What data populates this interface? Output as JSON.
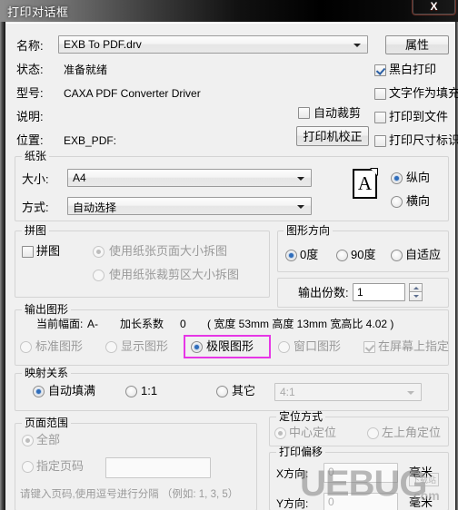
{
  "window": {
    "title": "打印对话框",
    "close_label": "X"
  },
  "printer": {
    "name_label": "名称:",
    "name_value": "EXB To PDF.drv",
    "properties_button": "属性",
    "status_label": "状态:",
    "status_value": "准备就绪",
    "model_label": "型号:",
    "model_value": "CAXA PDF Converter Driver",
    "desc_label": "说明:",
    "desc_value": "",
    "location_label": "位置:",
    "location_value": "EXB_PDF:",
    "auto_crop_label": "自动裁剪",
    "auto_crop_checked": false,
    "calibrate_button": "打印机校正",
    "options": [
      {
        "label": "黑白打印",
        "checked": true,
        "disabled": false
      },
      {
        "label": "文字作为填充",
        "checked": false,
        "disabled": false
      },
      {
        "label": "打印到文件",
        "checked": false,
        "disabled": false
      },
      {
        "label": "打印尺寸标识",
        "checked": false,
        "disabled": false
      }
    ]
  },
  "paper": {
    "group_title": "纸张",
    "size_label": "大小:",
    "size_value": "A4",
    "method_label": "方式:",
    "method_value": "自动选择",
    "icon_letter": "A",
    "orientation": [
      {
        "label": "纵向",
        "selected": true
      },
      {
        "label": "横向",
        "selected": false
      }
    ]
  },
  "tile": {
    "group_title": "拼图",
    "enable_label": "拼图",
    "enable_checked": false,
    "options": [
      {
        "label": "使用纸张页面大小拆图",
        "selected": true,
        "disabled": true
      },
      {
        "label": "使用纸张裁剪区大小拆图",
        "selected": false,
        "disabled": true
      }
    ]
  },
  "graphic_direction": {
    "group_title": "图形方向",
    "options": [
      {
        "label": "0度",
        "selected": true
      },
      {
        "label": "90度",
        "selected": false
      },
      {
        "label": "自适应",
        "selected": false
      }
    ],
    "copies_label": "输出份数:",
    "copies_value": "1"
  },
  "output_graphic": {
    "group_title": "输出图形",
    "current_size_label": "当前幅面:",
    "current_size_value": "A-",
    "extend_label": "加长系数",
    "extend_value": "0",
    "dims_text": "( 宽度 53mm      高度 13mm      宽高比 4.02  )",
    "width_label": "宽度",
    "width_value": "53mm",
    "height_label": "高度",
    "height_value": "13mm",
    "ratio_label": "宽高比",
    "ratio_value": "4.02",
    "options": [
      {
        "label": "标准图形",
        "selected": false,
        "disabled": true
      },
      {
        "label": "显示图形",
        "selected": false,
        "disabled": true
      },
      {
        "label": "极限图形",
        "selected": true,
        "disabled": false,
        "highlighted": true
      },
      {
        "label": "窗口图形",
        "selected": false,
        "disabled": true
      }
    ],
    "screen_pick_label": "在屏幕上指定",
    "screen_pick_checked": true,
    "screen_pick_disabled": true
  },
  "mapping": {
    "group_title": "映射关系",
    "options": [
      {
        "label": "自动填满",
        "selected": true
      },
      {
        "label": "1:1",
        "selected": false
      },
      {
        "label": "其它",
        "selected": false
      }
    ],
    "ratio_value": "4:1",
    "ratio_disabled": true
  },
  "page_range": {
    "group_title": "页面范围",
    "options": [
      {
        "label": "全部",
        "selected": true,
        "disabled": true
      },
      {
        "label": "指定页码",
        "selected": false,
        "disabled": true
      }
    ],
    "pages_value": "",
    "hint": "请键入页码,使用逗号进行分隔  （例如: 1, 3, 5）"
  },
  "positioning": {
    "group_title": "定位方式",
    "options": [
      {
        "label": "中心定位",
        "selected": true,
        "disabled": true
      },
      {
        "label": "左上角定位",
        "selected": false,
        "disabled": true
      }
    ]
  },
  "print_offset": {
    "group_title": "打印偏移",
    "x_label": "X方向:",
    "x_value": "0",
    "x_unit": "毫米",
    "y_label": "Y方向:",
    "y_value": "0",
    "y_unit": "毫米"
  },
  "watermark": {
    "big": "UEBUG",
    "small": ".com",
    "tag": "下载站"
  },
  "colors": {
    "accent": "#2f6dbb",
    "highlight": "#e636e6",
    "titlebar": "#000000",
    "close": "#c03a23"
  }
}
